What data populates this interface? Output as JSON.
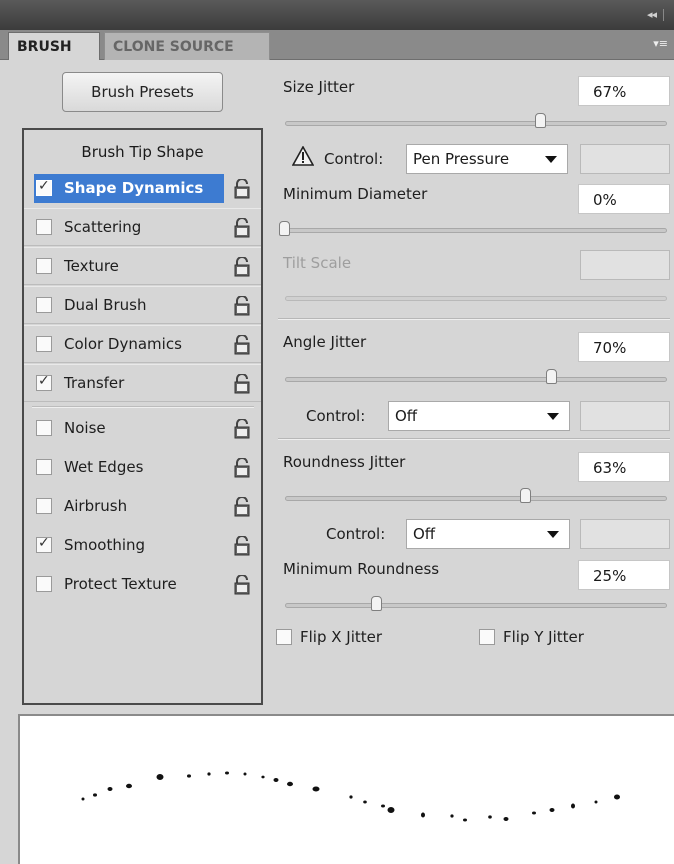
{
  "tabs": [
    {
      "label": "BRUSH",
      "active": true
    },
    {
      "label": "CLONE SOURCE",
      "active": false
    }
  ],
  "titlebar": {
    "collapse_glyph": "◂◂"
  },
  "brush_presets_button": "Brush Presets",
  "brush_tip_shape": "Brush Tip Shape",
  "options": [
    {
      "label": "Shape Dynamics",
      "checked": true,
      "selected": true
    },
    {
      "label": "Scattering",
      "checked": false
    },
    {
      "label": "Texture",
      "checked": false
    },
    {
      "label": "Dual Brush",
      "checked": false
    },
    {
      "label": "Color Dynamics",
      "checked": false
    },
    {
      "label": "Transfer",
      "checked": true
    },
    {
      "label": "Noise",
      "checked": false
    },
    {
      "label": "Wet Edges",
      "checked": false
    },
    {
      "label": "Airbrush",
      "checked": false
    },
    {
      "label": "Smoothing",
      "checked": true
    },
    {
      "label": "Protect Texture",
      "checked": false
    }
  ],
  "settings": {
    "size_jitter": {
      "label": "Size Jitter",
      "value": "67%",
      "slider": 0.67
    },
    "size_control": {
      "label": "Control:",
      "value": "Pen Pressure"
    },
    "minimum_diameter": {
      "label": "Minimum Diameter",
      "value": "0%",
      "slider": 0.0
    },
    "tilt_scale": {
      "label": "Tilt Scale",
      "value": "",
      "disabled": true
    },
    "angle_jitter": {
      "label": "Angle Jitter",
      "value": "70%",
      "slider": 0.7
    },
    "angle_control": {
      "label": "Control:",
      "value": "Off"
    },
    "roundness_jitter": {
      "label": "Roundness Jitter",
      "value": "63%",
      "slider": 0.63
    },
    "roundness_control": {
      "label": "Control:",
      "value": "Off"
    },
    "minimum_roundness": {
      "label": "Minimum Roundness",
      "value": "25%",
      "slider": 0.25
    },
    "flip_x": {
      "label": "Flip X Jitter",
      "checked": false
    },
    "flip_y": {
      "label": "Flip Y Jitter",
      "checked": false
    }
  },
  "icons": {
    "lock": "lock-icon",
    "warning": "warning-icon",
    "dropdown": "chevron-down-icon",
    "panel_menu": "panel-menu-icon"
  },
  "colors": {
    "selection": "#3d7bd1",
    "panel_bg": "#d6d6d6",
    "tabbar_bg": "#8a8a8a"
  }
}
